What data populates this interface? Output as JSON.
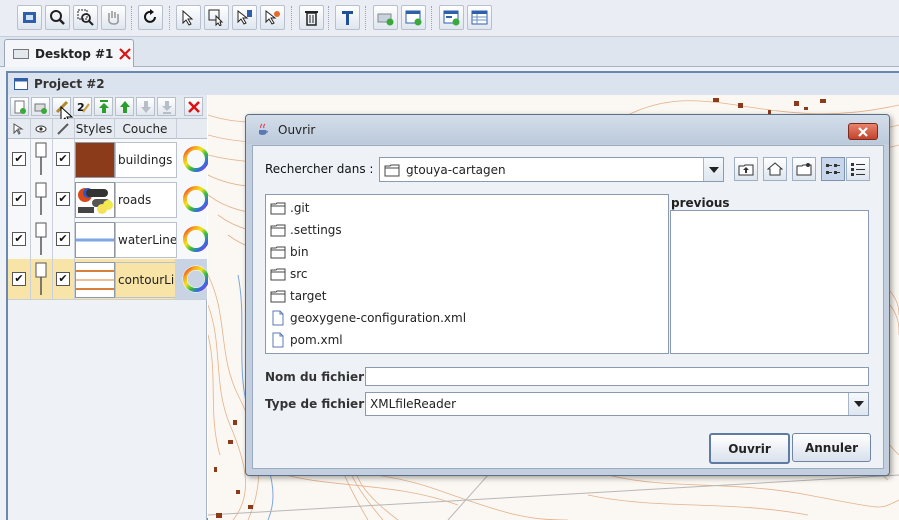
{
  "toolbar": {
    "buttons": [
      "zoom-extent-icon",
      "zoom-in-icon",
      "zoom-box-icon",
      "pan-hand-icon",
      "refresh-icon",
      "select-arrow-icon",
      "select-box-icon",
      "select-info-icon",
      "select-clear-icon",
      "delete-icon",
      "measure-icon",
      "add-layer-icon",
      "add-window-icon",
      "new-window-icon",
      "table-icon"
    ]
  },
  "desktop": {
    "tab_label": "Desktop #1"
  },
  "project": {
    "title": "Project #2",
    "columns": {
      "styles": "Styles",
      "layer": "Couche"
    },
    "layers": [
      {
        "name": "buildings",
        "visible": true,
        "selectable": true,
        "style": "fill-brown"
      },
      {
        "name": "roads",
        "visible": true,
        "selectable": true,
        "style": "roads-mix"
      },
      {
        "name": "waterLine",
        "visible": true,
        "selectable": true,
        "style": "line-blue"
      },
      {
        "name": "contourLir",
        "visible": true,
        "selectable": true,
        "style": "line-brown",
        "selected": true
      }
    ]
  },
  "dialog": {
    "title": "Ouvrir",
    "look_in_label": "Rechercher dans :",
    "look_in_value": "gtouya-cartagen",
    "files": [
      {
        "name": ".git",
        "type": "folder"
      },
      {
        "name": ".settings",
        "type": "folder"
      },
      {
        "name": "bin",
        "type": "folder"
      },
      {
        "name": "src",
        "type": "folder"
      },
      {
        "name": "target",
        "type": "folder"
      },
      {
        "name": "geoxygene-configuration.xml",
        "type": "file"
      },
      {
        "name": "pom.xml",
        "type": "file"
      }
    ],
    "preview_label": "previous",
    "filename_label": "Nom du fichier :",
    "filename_value": "",
    "filetype_label": "Type de fichier :",
    "filetype_value": "XMLfileReader",
    "open_button": "Ouvrir",
    "cancel_button": "Annuler"
  },
  "colors": {
    "accent": "#6b88b1",
    "selected_row": "#f7e4a6",
    "building": "#8b3a1a",
    "water": "#7ea6e0",
    "contour": "#d8803a"
  }
}
